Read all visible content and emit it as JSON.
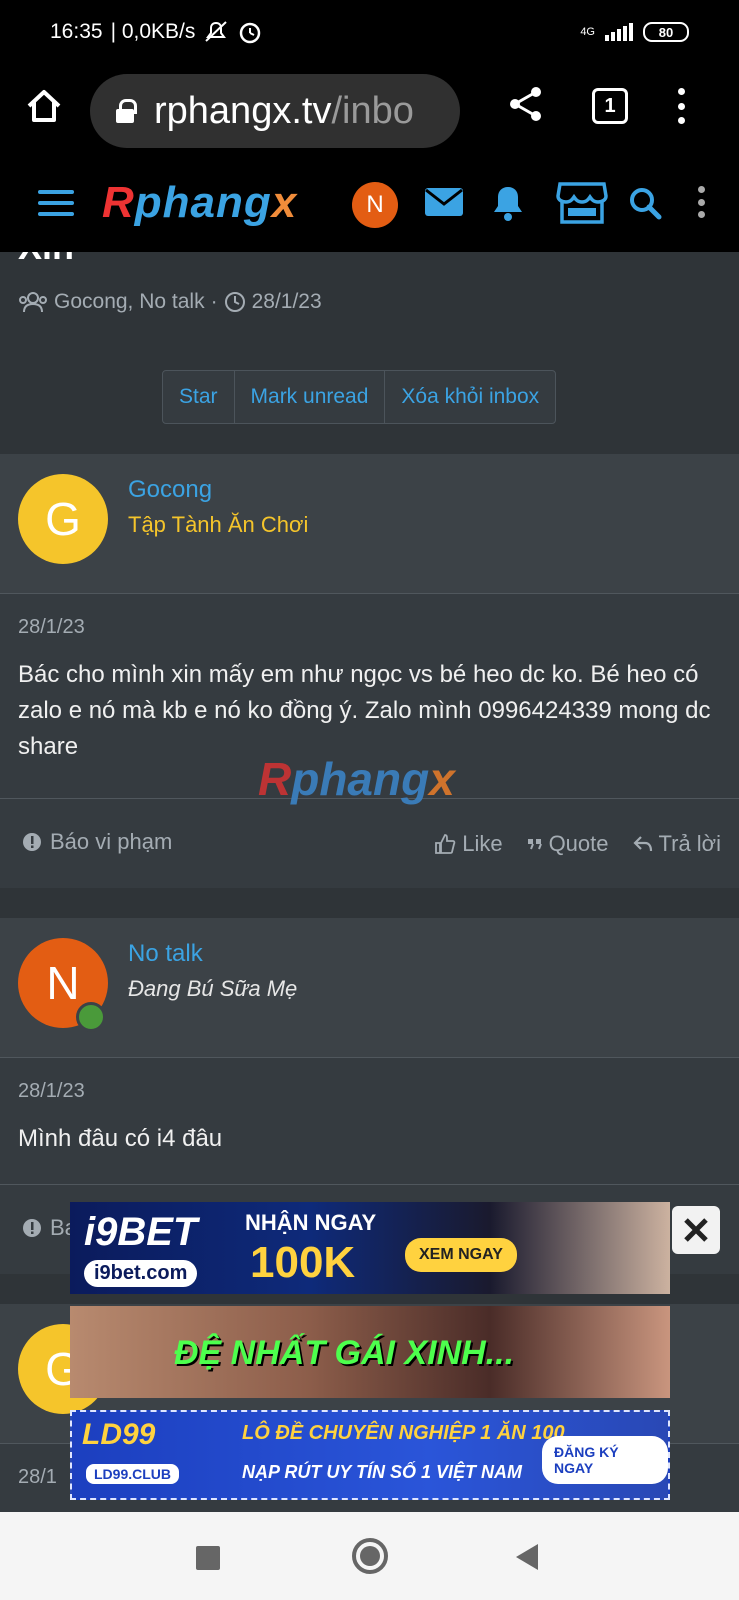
{
  "statusbar": {
    "time": "16:35",
    "net": "| 0,0KB/s",
    "network_type": "4G",
    "battery": "80"
  },
  "browser": {
    "url_host": "rphangx.tv",
    "url_path": "/inbo",
    "tab_count": "1"
  },
  "site": {
    "logo_parts": [
      "R",
      "phang",
      "x"
    ],
    "user_initial": "N",
    "colors": {
      "accent": "#3ba3e3",
      "orange": "#e35d13",
      "bg": "#2f3438"
    }
  },
  "conversation": {
    "title": "Xin",
    "participants": "Gocong, No talk",
    "separator": "·",
    "date": "28/1/23",
    "buttons": {
      "star": "Star",
      "mark_unread": "Mark unread",
      "remove": "Xóa khỏi inbox"
    }
  },
  "messages": [
    {
      "initial": "G",
      "avatar_color": "#f5c52b",
      "name": "Gocong",
      "role": "Tập Tành Ăn Chơi",
      "role_color": "#f5c52b",
      "date": "28/1/23",
      "text": "Bác cho mình xin mấy em như ngọc vs bé heo dc ko. Bé heo có zalo e nó mà kb e nó ko đồng ý. Zalo mình 0996424339 mong dc share"
    },
    {
      "initial": "N",
      "avatar_color": "#e35d13",
      "name": "No talk",
      "role": "Đang Bú Sữa Mẹ",
      "role_color": "#e6e6e6",
      "date": "28/1/23",
      "text": "Mình đâu có i4 đâu"
    },
    {
      "initial": "G",
      "date": "28/1"
    }
  ],
  "footer_actions": {
    "report": "Báo vi phạm",
    "report_partial": "Ba",
    "like": "Like",
    "quote": "Quote",
    "reply": "Trả lời"
  },
  "ads": {
    "ad1": {
      "brand": "i9BET",
      "domain": "i9bet.com",
      "headline": "NHẬN NGAY",
      "amount": "100K",
      "cta": "XEM NGAY"
    },
    "ad2": {
      "text": "ĐỆ NHẤT GÁI XINH..."
    },
    "ad3": {
      "brand": "LD99",
      "club": "LD99.CLUB",
      "line1": "LÔ ĐỀ CHUYÊN NGHIỆP 1 ĂN 100",
      "line2": "NẠP RÚT UY TÍN SỐ 1 VIỆT NAM",
      "cta": "ĐĂNG KÝ NGAY"
    }
  }
}
